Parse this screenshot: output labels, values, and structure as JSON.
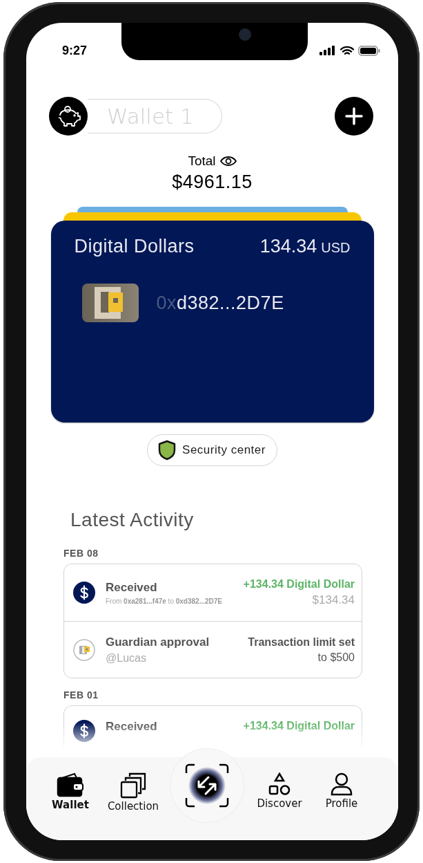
{
  "status_bar": {
    "time": "9:27"
  },
  "header": {
    "wallet_name": "Wallet 1"
  },
  "total": {
    "label": "Total",
    "amount": "$4961.15"
  },
  "back_cards": [
    {
      "color": "#6aaee2"
    },
    {
      "color": "#f7c600"
    }
  ],
  "card": {
    "name": "Digital Dollars",
    "amount": "134.34",
    "currency": "USD",
    "address_prefix": "0x",
    "address_body": "d382...2D7E"
  },
  "security_button": "Security center",
  "activity": {
    "title": "Latest Activity",
    "groups": [
      {
        "date": "FEB 08",
        "items": [
          {
            "kind": "received",
            "title": "Received",
            "detail": "From **0xa281...f47e** to **0xd382...2D7E**",
            "amount": "+134.34 Digital Dollar",
            "value": "$134.34"
          },
          {
            "kind": "guardian",
            "title": "Guardian approval",
            "detail": "@Lucas",
            "amount": "Transaction limit set",
            "value": "to $500"
          }
        ]
      },
      {
        "date": "FEB 01",
        "items": [
          {
            "kind": "received",
            "title": "Received",
            "amount": "+134.34 Digital Dollar"
          }
        ]
      }
    ]
  },
  "nav": [
    {
      "kind": "wallet",
      "label": "Wallet",
      "selected": true
    },
    {
      "kind": "collection",
      "label": "Collection",
      "selected": false
    },
    {
      "kind": "scan",
      "selected": false
    },
    {
      "kind": "discover",
      "label": "Discover",
      "selected": false
    },
    {
      "kind": "profile",
      "label": "Profile",
      "selected": false
    }
  ]
}
